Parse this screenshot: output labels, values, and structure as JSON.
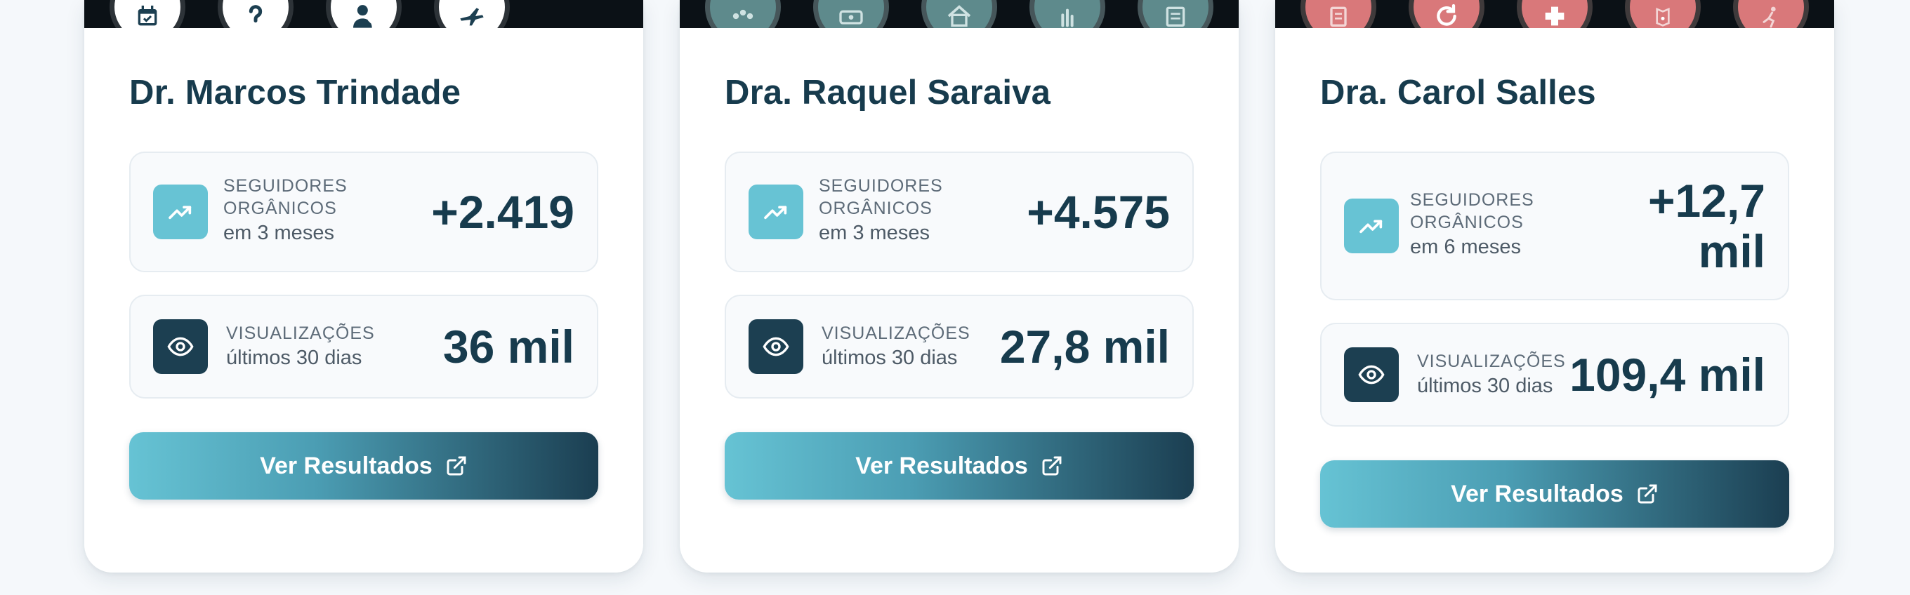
{
  "colors": {
    "accent_teal": "#67c3d4",
    "dark_navy": "#1c3f51",
    "title_text": "#173b4d",
    "pink_badge": "#d9787a"
  },
  "cards": [
    {
      "name": "Dr. Marcos Trindade",
      "banner_icons": [
        "calendar-icon",
        "question-icon",
        "doctor-icon",
        "airplane-icon"
      ],
      "followers": {
        "label_line1": "SEGUIDORES",
        "label_line2": "ORGÂNICOS",
        "period": "em 3 meses",
        "value": "+2.419"
      },
      "views": {
        "label": "VISUALIZAÇÕES",
        "period": "últimos 30 dias",
        "value": "36 mil"
      },
      "button_label": "Ver Resultados"
    },
    {
      "name": "Dra. Raquel Saraiva",
      "banner_icons": [
        "people-icon",
        "money-icon",
        "house-icon",
        "hand-icon",
        "document-icon"
      ],
      "followers": {
        "label_line1": "SEGUIDORES",
        "label_line2": "ORGÂNICOS",
        "period": "em 3 meses",
        "value": "+4.575"
      },
      "views": {
        "label": "VISUALIZAÇÕES",
        "period": "últimos 30 dias",
        "value": "27,8 mil"
      },
      "button_label": "Ver Resultados"
    },
    {
      "name": "Dra. Carol Salles",
      "banner_icons": [
        "clipboard-icon",
        "refresh-icon",
        "cross-icon",
        "map-icon",
        "person-icon"
      ],
      "followers": {
        "label_line1": "SEGUIDORES",
        "label_line2": "ORGÂNICOS",
        "period": "em 6 meses",
        "value": "+12,7 mil"
      },
      "views": {
        "label": "VISUALIZAÇÕES",
        "period": "últimos 30 dias",
        "value": "109,4 mil"
      },
      "button_label": "Ver Resultados"
    }
  ]
}
